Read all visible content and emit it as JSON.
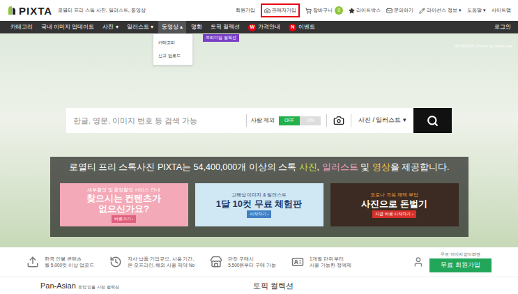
{
  "header": {
    "logo": "PIXTA",
    "tagline": "로열티 프리 스톡 사진, 일러스트, 동영상",
    "links": [
      {
        "label": "회원가입",
        "kind": "plain",
        "highlighted": false
      },
      {
        "label": "판매자가입",
        "kind": "seller",
        "highlighted": true
      },
      {
        "label": "장바구니",
        "kind": "cart",
        "highlighted": false,
        "badge": "0"
      },
      {
        "label": "라이트박스",
        "kind": "lightbox",
        "highlighted": false
      },
      {
        "label": "문의하기",
        "kind": "contact",
        "highlighted": false
      },
      {
        "label": "라이선스 정보 ▾",
        "kind": "license",
        "highlighted": false
      },
      {
        "label": "도움말 ▾",
        "kind": "plain",
        "highlighted": false
      },
      {
        "label": "사이트맵",
        "kind": "plain",
        "highlighted": false
      }
    ]
  },
  "nav": {
    "items": [
      {
        "label": "카테고리",
        "selected": false
      },
      {
        "label": "국내 이미지 업데이트",
        "selected": false
      },
      {
        "label": "사진 ▾",
        "selected": false
      },
      {
        "label": "일러스트 ▾",
        "selected": false
      },
      {
        "label": "동영상 ▴",
        "selected": true,
        "expanded": true,
        "menu": [
          "카테고리",
          "신규 업로드"
        ]
      },
      {
        "label": "명화",
        "selected": false
      },
      {
        "label": "토픽 컬렉션",
        "selected": false,
        "tag": "프리미엄 컬렉션"
      },
      {
        "label": "가격안내",
        "selected": false,
        "badge": "W"
      },
      {
        "label": "이벤트",
        "selected": false,
        "badge": "N"
      }
    ],
    "login": "로그인"
  },
  "hero": {
    "credit": "58750538 | Photo by Jieun Lee",
    "search": {
      "placeholder": "한글, 영문, 이미지 번호 등 검색 가능",
      "exclude": "사람 제외",
      "toggle": {
        "off": "OFF",
        "on": "ON",
        "value": false
      },
      "type": "사진 / 일러스트 ▾"
    },
    "headline": [
      {
        "text": "로열티 프리 스톡사진 PIXTA는 54,400,000개 이상의 스톡 ",
        "color": "#ffffff"
      },
      {
        "text": "사진",
        "color": "#c8e03c"
      },
      {
        "text": ", ",
        "color": "#ffffff"
      },
      {
        "text": "일러스트",
        "color": "#f6a3c4"
      },
      {
        "text": " 및 ",
        "color": "#ffffff"
      },
      {
        "text": "영상",
        "color": "#f7c948"
      },
      {
        "text": "을 제공합니다.",
        "color": "#ffffff"
      }
    ],
    "banners": [
      {
        "small": "세부촬영 및 출장촬영 서비스 안내",
        "lines": [
          "찾으시는 컨텐츠가",
          "없으신가요?"
        ],
        "button": "바로가기 ›",
        "color": "#f4a9b8"
      },
      {
        "small": "고해상 이미지 & 일러스트",
        "lines": [
          "1달 10컷 무료 체험판"
        ],
        "button": "시작하기 ›",
        "color": "#cfe8f4"
      },
      {
        "small": "코로나 극복 재택 부업",
        "lines": [
          "사진으로 돈벌기"
        ],
        "button": "지금 바로 시작하기 ›",
        "color": "#3b2b22"
      }
    ]
  },
  "features": [
    {
      "kind": "upload",
      "lines": [
        "한국 인물 콘텐츠",
        "월 5,000컷 이상 업로드"
      ]
    },
    {
      "kind": "history",
      "lines": [
        "자사·납품·기업규모, 사용 기간,",
        "온·오프라인, 해외 사용 제약 No"
      ]
    },
    {
      "kind": "store",
      "lines": [
        "단컷 구매시",
        "5,500원부터 구매 가능"
      ]
    },
    {
      "kind": "plan",
      "lines": [
        "1개월 단위 부터",
        "사용 가능한 정액제"
      ]
    }
  ],
  "signup": {
    "note": "무료 이미지 받으려면",
    "button": "무료 회원가입"
  },
  "sections": [
    {
      "title": "Pan-Asian",
      "sub": "동양 인물 사진 컬렉션"
    },
    {
      "title": "토픽 컬렉션",
      "sub": ""
    }
  ]
}
